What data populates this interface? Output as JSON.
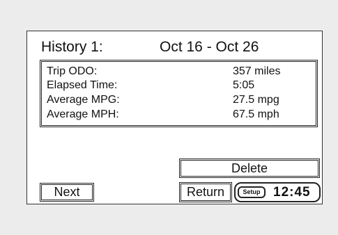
{
  "header": {
    "title": "History 1:",
    "date_range": "Oct 16 - Oct 26"
  },
  "stats": [
    {
      "label": "Trip ODO:",
      "value": "357 miles"
    },
    {
      "label": "Elapsed Time:",
      "value": "5:05"
    },
    {
      "label": "Average MPG:",
      "value": "27.5 mpg"
    },
    {
      "label": "Average MPH:",
      "value": "67.5 mph"
    }
  ],
  "buttons": {
    "delete": "Delete",
    "next": "Next",
    "return": "Return",
    "setup": "Setup"
  },
  "clock": {
    "time": "12:45"
  }
}
